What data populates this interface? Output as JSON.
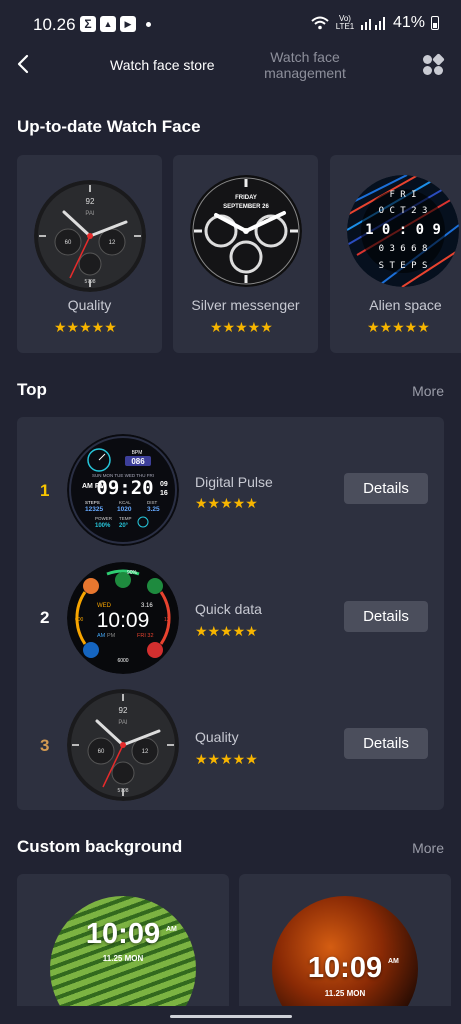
{
  "status": {
    "time": "10.26",
    "signal_label": "Vo) LTE1",
    "battery": "41%"
  },
  "header": {
    "tab_store": "Watch face store",
    "tab_manage": "Watch face management"
  },
  "latest": {
    "title": "Up-to-date Watch Face",
    "cards": [
      {
        "name": "Quality",
        "stars": "★★★★★"
      },
      {
        "name": "Silver messenger",
        "stars": "★★★★★"
      },
      {
        "name": "Alien space",
        "stars": "★★★★★"
      }
    ]
  },
  "faces": {
    "quality": {
      "top": "92",
      "brand": "PAI",
      "left": "60",
      "right": "12",
      "bottom": "5798"
    },
    "silver": {
      "day": "FRIDAY",
      "date": "SEPTEMBER 26"
    },
    "alien": {
      "row1": "F R I",
      "row2": "O C T 2 3",
      "time": "1 0 : 0 9",
      "row4": "0 3 6 6 8",
      "row5": "S T E P S"
    },
    "digital": {
      "bpm": "BPM",
      "hr": "086",
      "days": "SUN MON TUE WED THU FRI",
      "ampm": "AM PM",
      "time": "09:20",
      "date1": "09",
      "date2": "16",
      "steps_l": "STEPS",
      "steps": "12325",
      "kcal_l": "KCAL",
      "kcal": "1020",
      "dist_l": "DIST",
      "dist": "3.25",
      "power_l": "POWER",
      "power": "100%",
      "temp_l": "TEMP",
      "temp": "20°"
    },
    "quick": {
      "battery": "90%",
      "day": "WED",
      "dnum": "3.16",
      "time": "10:09",
      "am": "AM",
      "pm": "PM",
      "date": "FRI 32",
      "left": "600",
      "right": "12",
      "steps": "6000"
    }
  },
  "top": {
    "title": "Top",
    "more": "More",
    "items": [
      {
        "rank": "1",
        "name": "Digital Pulse",
        "stars": "★★★★★",
        "button": "Details"
      },
      {
        "rank": "2",
        "name": "Quick data",
        "stars": "★★★★★",
        "button": "Details"
      },
      {
        "rank": "3",
        "name": "Quality",
        "stars": "★★★★★",
        "button": "Details"
      }
    ]
  },
  "custom": {
    "title": "Custom background",
    "more": "More",
    "cards": [
      {
        "time": "10:09",
        "ampm": "AM",
        "date": "11.25 MON"
      },
      {
        "time": "10:09",
        "ampm": "AM",
        "date": "11.25 MON"
      }
    ]
  },
  "colors": {
    "background": "#212332",
    "card": "#2d303f",
    "star": "#f7b500",
    "rank1": "#f7c500",
    "rank3": "#d39a52"
  }
}
